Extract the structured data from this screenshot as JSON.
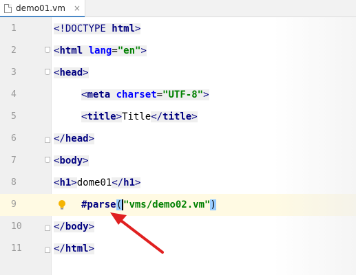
{
  "tab": {
    "file_name": "demo01.vm",
    "close_glyph": "×",
    "icon": "file-icon"
  },
  "editor": {
    "current_line": 9,
    "lines": [
      {
        "n": "1"
      },
      {
        "n": "2"
      },
      {
        "n": "3"
      },
      {
        "n": "4"
      },
      {
        "n": "5"
      },
      {
        "n": "6"
      },
      {
        "n": "7"
      },
      {
        "n": "8"
      },
      {
        "n": "9"
      },
      {
        "n": "10"
      },
      {
        "n": "11"
      }
    ],
    "tokens": {
      "doctype_open": "<!DOCTYPE ",
      "doctype_name": "html",
      "doctype_close": ">",
      "lt": "<",
      "lt_slash": "</",
      "gt": ">",
      "html": "html",
      "lang_attr": "lang",
      "eq": "=",
      "lang_val": "\"en\"",
      "head": "head",
      "meta": "meta",
      "charset_attr": "charset",
      "charset_val": "\"UTF-8\"",
      "title": "title",
      "title_text": "Title",
      "body": "body",
      "h1": "h1",
      "h1_text": "dome01",
      "parse_directive": "#parse",
      "paren_open": "(",
      "paren_close": ")",
      "parse_arg": "\"vms/demo02.vm\""
    }
  },
  "annotation": {
    "arrow_color": "#e02020",
    "bulb_color": "#f5b400"
  }
}
